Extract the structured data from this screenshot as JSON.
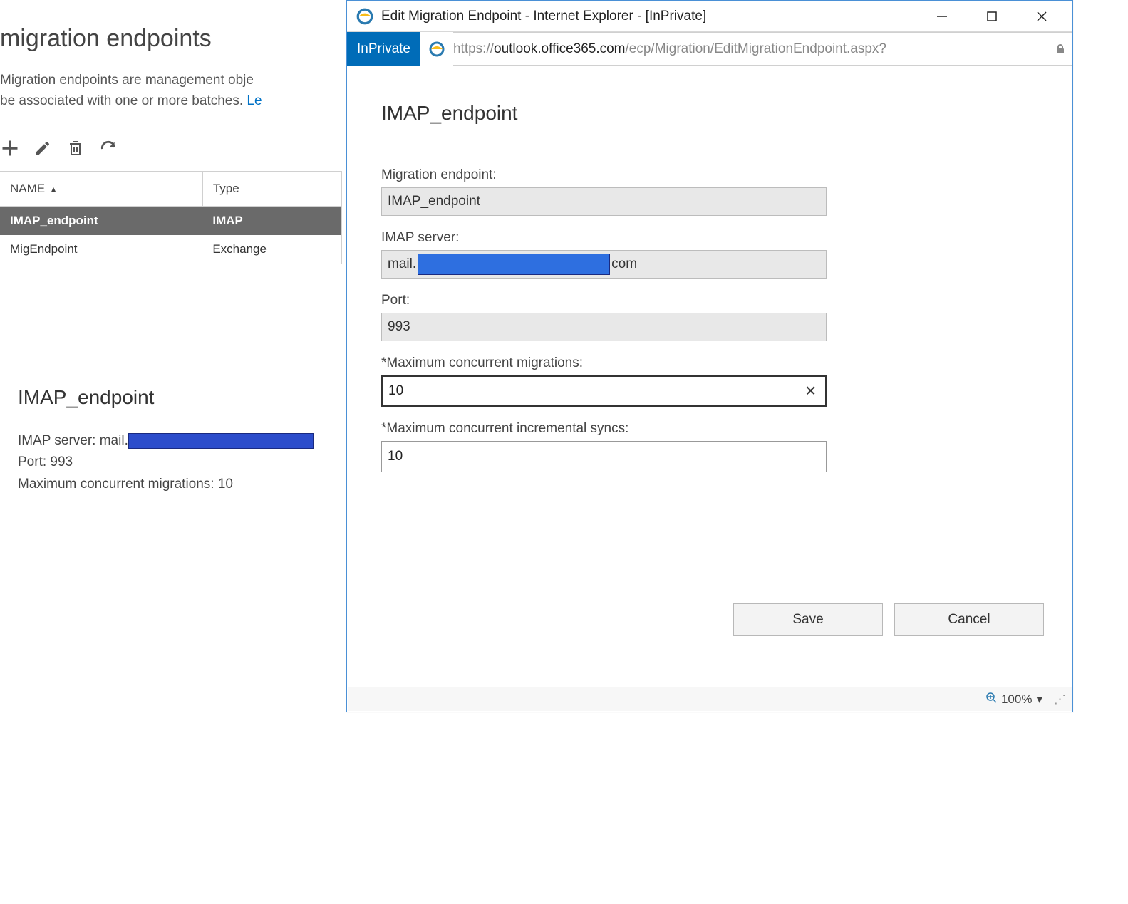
{
  "bg": {
    "title": "migration endpoints",
    "desc_a": "Migration endpoints are management obje",
    "desc_b": "be associated with one or more batches. ",
    "desc_link": "Le",
    "toolbar": {
      "add": "add",
      "edit": "edit",
      "delete": "delete",
      "refresh": "refresh"
    },
    "columns": {
      "name": "NAME",
      "type": "Type"
    },
    "rows": [
      {
        "name": "IMAP_endpoint",
        "type": "IMAP",
        "selected": true
      },
      {
        "name": "MigEndpoint",
        "type": "Exchange",
        "selected": false
      }
    ],
    "details": {
      "title": "IMAP_endpoint",
      "server_label": "IMAP server: mail.",
      "port_line": "Port: 993",
      "max_line": "Maximum concurrent migrations: 10"
    }
  },
  "ie": {
    "window_title": "Edit Migration Endpoint - Internet Explorer - [InPrivate]",
    "inprivate": "InPrivate",
    "url_gray1": "https://",
    "url_dark": "outlook.office365.com",
    "url_gray2": "/ecp/Migration/EditMigrationEndpoint.aspx?",
    "zoom": "100%"
  },
  "dialog": {
    "title": "IMAP_endpoint",
    "endpoint_label": "Migration endpoint:",
    "endpoint_value": "IMAP_endpoint",
    "server_label": "IMAP server:",
    "server_prefix": "mail.",
    "server_suffix": "com",
    "port_label": "Port:",
    "port_value": "993",
    "max_migrations_label": "*Maximum concurrent migrations:",
    "max_migrations_value": "10",
    "max_syncs_label": "*Maximum concurrent incremental syncs:",
    "max_syncs_value": "10",
    "save": "Save",
    "cancel": "Cancel"
  }
}
